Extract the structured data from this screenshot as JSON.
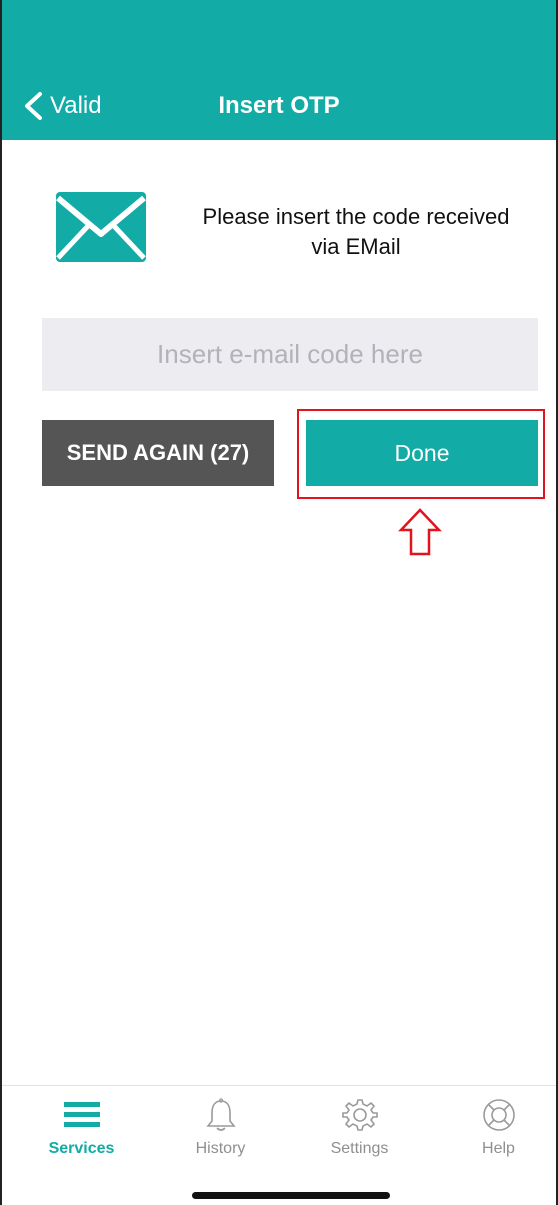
{
  "colors": {
    "accent": "#12aba6",
    "highlight": "#e0131e",
    "send_again_bg": "#555555",
    "input_bg": "#ececf1"
  },
  "header": {
    "back_label": "Valid",
    "title": "Insert OTP"
  },
  "instruction": {
    "icon": "envelope-icon",
    "line1": "Please insert the code received",
    "line2": "via EMail"
  },
  "code_input": {
    "value": "",
    "placeholder": "Insert e-mail code here"
  },
  "buttons": {
    "send_again": "SEND AGAIN (27)",
    "done": "Done"
  },
  "tabbar": {
    "items": [
      {
        "label": "Services",
        "icon": "menu-icon",
        "active": true
      },
      {
        "label": "History",
        "icon": "bell-icon",
        "active": false
      },
      {
        "label": "Settings",
        "icon": "gear-icon",
        "active": false
      },
      {
        "label": "Help",
        "icon": "lifebuoy-icon",
        "active": false
      }
    ]
  }
}
